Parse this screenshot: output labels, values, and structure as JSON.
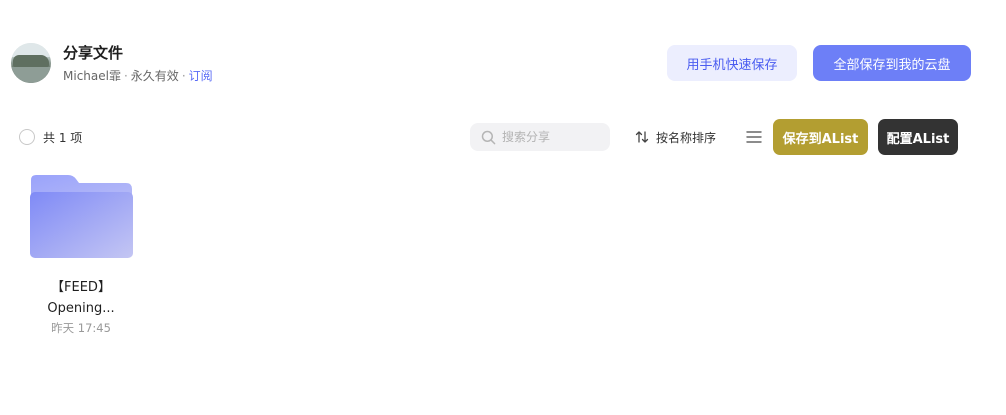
{
  "header": {
    "title": "分享文件",
    "owner": "Michael霏",
    "separator": "·",
    "validity": "永久有效",
    "subscribe": "订阅",
    "save_phone_button": "用手机快速保存",
    "save_all_button": "全部保存到我的云盘"
  },
  "toolbar": {
    "count_label": "共 1 项",
    "search_placeholder": "搜索分享",
    "search_value": "",
    "sort_label": "按名称排序",
    "save_alist_button": "保存到AList",
    "config_alist_button": "配置AList"
  },
  "files": [
    {
      "name_line1": "【FEED】",
      "name_line2": "Opening...",
      "date": "昨天 17:45",
      "icon": "folder-icon"
    }
  ],
  "colors": {
    "primary": "#6d7ff7",
    "primary_light": "#eceefe",
    "alist_gold": "#b39e31",
    "dark": "#333333",
    "folder_back": "#a4acf9",
    "folder_front": "#8f98f4"
  }
}
